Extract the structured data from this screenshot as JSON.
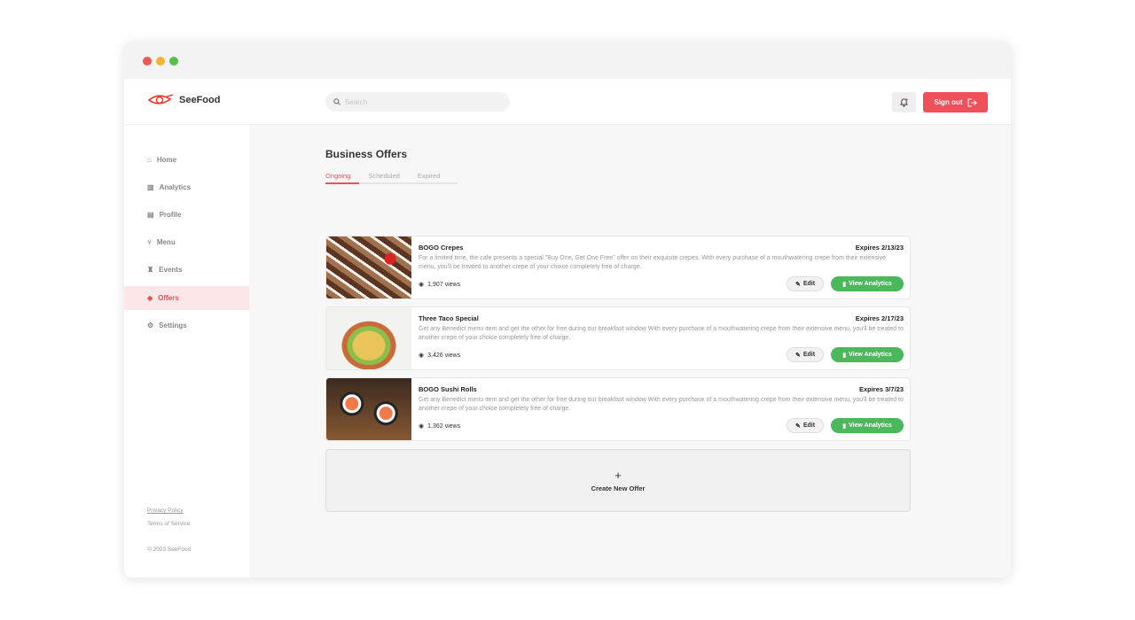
{
  "window": {
    "controls": [
      "close",
      "minimize",
      "maximize"
    ]
  },
  "header": {
    "brand": "SeeFood",
    "search_placeholder": "Search",
    "signout_label": "Sign out"
  },
  "sidebar": {
    "items": [
      {
        "label": "Home",
        "icon": "home-icon"
      },
      {
        "label": "Analytics",
        "icon": "bar-chart-icon"
      },
      {
        "label": "Profile",
        "icon": "id-card-icon"
      },
      {
        "label": "Menu",
        "icon": "utensils-icon"
      },
      {
        "label": "Events",
        "icon": "glasses-icon"
      },
      {
        "label": "Offers",
        "icon": "tag-icon",
        "active": true
      },
      {
        "label": "Settings",
        "icon": "gear-icon"
      }
    ],
    "privacy": "Privacy Policy",
    "terms": "Terms of Service",
    "copyright": "© 2023 SeeFood"
  },
  "main": {
    "title": "Business Offers",
    "tabs": [
      "Ongoing",
      "Scheduled",
      "Expired"
    ],
    "offers": [
      {
        "title": "BOGO Crepes",
        "expires": "Expires 2/13/23",
        "description": "For a limited time, the cafe presents a special \"Buy One, Get One Free\" offer on their exquisite crepes. With every purchase of a mouthwatering crepe from their extensive menu, you'll be treated to another crepe of your choice completely free of charge.",
        "views": "1,907 views",
        "edit": "Edit",
        "analytics": "View Analytics"
      },
      {
        "title": "Three Taco Special",
        "expires": "Expires 2/17/23",
        "description": "Get any Benedict menu item and get the other for free during our breakfast window With every purchase of a mouthwatering crepe from their extensive menu, you'll be treated to another crepe of your choice completely free of charge.",
        "views": "3,426 views",
        "edit": "Edit",
        "analytics": "View Analytics"
      },
      {
        "title": "BOGO Sushi Rolls",
        "expires": "Expires 3/7/23",
        "description": "Get any Benedict menu item and get the other for free during our breakfast window With every purchase of a mouthwatering crepe from their extensive menu, you'll be treated to another crepe of your choice completely free of charge.",
        "views": "1,362 views",
        "edit": "Edit",
        "analytics": "View Analytics"
      }
    ],
    "create_label": "Create New Offer"
  },
  "colors": {
    "accent": "#f0505a",
    "success": "#4cb85c"
  }
}
